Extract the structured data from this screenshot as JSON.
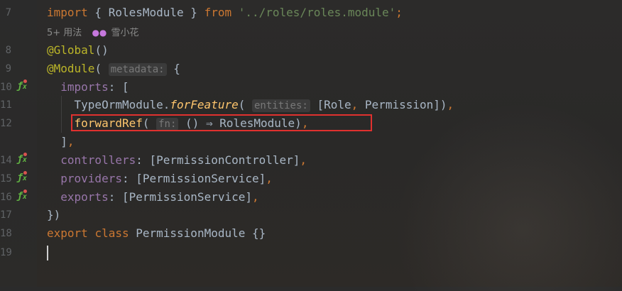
{
  "editor": {
    "lines": [
      {
        "no": "7",
        "tokens": [
          {
            "t": "import",
            "c": "kw"
          },
          {
            "t": " { RolesModule } "
          },
          {
            "t": "from",
            "c": "kw"
          },
          {
            "t": " "
          },
          {
            "t": "'../roles/roles.module'",
            "c": "str"
          },
          {
            "t": ";",
            "c": "kw"
          }
        ]
      },
      {
        "no": "8",
        "tokens": [
          {
            "t": "@Global",
            "c": "ann"
          },
          {
            "t": "()"
          }
        ]
      },
      {
        "no": "9",
        "tokens": [
          {
            "t": "@Module",
            "c": "ann"
          },
          {
            "t": "( "
          },
          {
            "t": "metadata:",
            "c": "hint"
          },
          {
            "t": " {"
          }
        ]
      },
      {
        "no": "10",
        "fx": true,
        "tokens": [
          {
            "t": "  "
          },
          {
            "t": "imports",
            "c": "prop"
          },
          {
            "t": ": ["
          }
        ]
      },
      {
        "no": "11",
        "tokens": [
          {
            "t": "    TypeOrmModule."
          },
          {
            "t": "forFeature",
            "c": "fn-italic"
          },
          {
            "t": "( "
          },
          {
            "t": "entities:",
            "c": "hint"
          },
          {
            "t": " [Role"
          },
          {
            "t": ",",
            "c": "kw"
          },
          {
            "t": " Permission])"
          },
          {
            "t": ",",
            "c": "kw"
          }
        ]
      },
      {
        "no": "12",
        "tokens": [
          {
            "t": "    "
          },
          {
            "t": "forwardRef",
            "c": "fn"
          },
          {
            "t": "( "
          },
          {
            "t": "fn:",
            "c": "hint"
          },
          {
            "t": " () ⇒ RolesModule)"
          },
          {
            "t": ",",
            "c": "kw"
          }
        ]
      },
      {
        "no": "",
        "tokens": [
          {
            "t": "  ]"
          },
          {
            "t": ",",
            "c": "kw"
          }
        ]
      },
      {
        "no": "14",
        "fx": true,
        "tokens": [
          {
            "t": "  "
          },
          {
            "t": "controllers",
            "c": "prop"
          },
          {
            "t": ": [PermissionController]"
          },
          {
            "t": ",",
            "c": "kw"
          }
        ]
      },
      {
        "no": "15",
        "fx": true,
        "tokens": [
          {
            "t": "  "
          },
          {
            "t": "providers",
            "c": "prop"
          },
          {
            "t": ": [PermissionService]"
          },
          {
            "t": ",",
            "c": "kw"
          }
        ]
      },
      {
        "no": "16",
        "fx": true,
        "tokens": [
          {
            "t": "  "
          },
          {
            "t": "exports",
            "c": "prop"
          },
          {
            "t": ": [PermissionService]"
          },
          {
            "t": ",",
            "c": "kw"
          }
        ]
      },
      {
        "no": "17",
        "tokens": [
          {
            "t": "})"
          }
        ]
      },
      {
        "no": "18",
        "tokens": [
          {
            "t": "export",
            "c": "kw"
          },
          {
            "t": " "
          },
          {
            "t": "class",
            "c": "kw"
          },
          {
            "t": " PermissionModule {}"
          }
        ]
      },
      {
        "no": "19",
        "tokens": []
      }
    ],
    "usage_hint": {
      "usages": "5+ 用法",
      "author": "雪小花"
    },
    "colors": {
      "highlight_box": "#e0312f",
      "keyword": "#cc7832",
      "string": "#6a8759",
      "annotation": "#bbb529",
      "function": "#ffc66d",
      "property": "#9876aa"
    },
    "icons": {
      "gutter_marker": "fx-icon",
      "author": "user-group-icon"
    }
  }
}
